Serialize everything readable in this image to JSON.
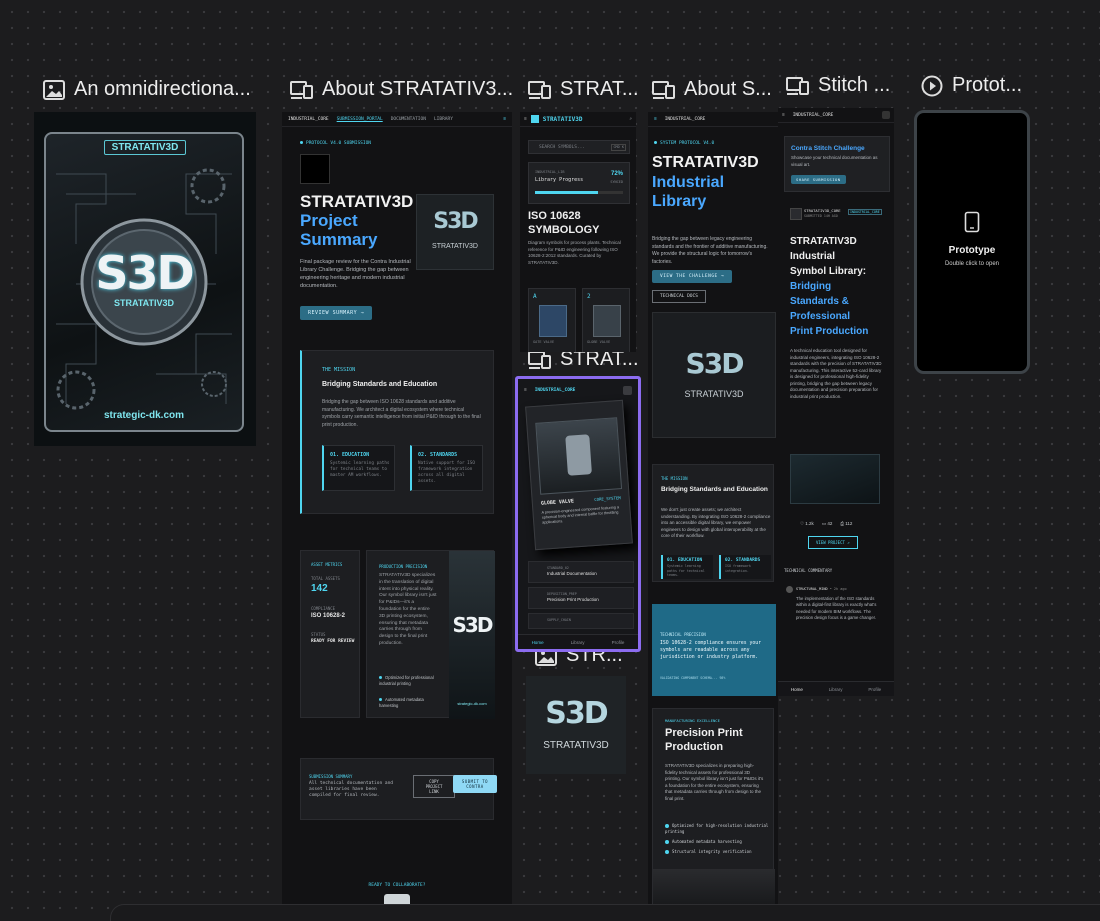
{
  "tiles": [
    {
      "title": "An omnidirectiona..."
    },
    {
      "title": "About STRATATIV3..."
    },
    {
      "title": "STRAT..."
    },
    {
      "title": "About S..."
    },
    {
      "title": "Stitch ..."
    },
    {
      "title": "Protot..."
    },
    {
      "title": "STRAT..."
    },
    {
      "title": "STR..."
    }
  ],
  "card_art": {
    "brand": "STRATATIV3D",
    "logo": "S3D",
    "url": "strategic-dk.com"
  },
  "about1": {
    "nav": [
      "INDUSTRIAL_CORE",
      "SUBMISSION_PORTAL",
      "DOCUMENTATION",
      "LIBRARY"
    ],
    "tag": "PROTOCOL V4.0 SUBMISSION",
    "h1": "STRATATIV3D",
    "h2": "Project",
    "h3": "Summary",
    "logo_text": "STRATATIV3D",
    "intro": "Final package review for the Contra Industrial Library Challenge. Bridging the gap between engineering heritage and modern industrial documentation.",
    "cta": "REVIEW SUMMARY →",
    "mission_tag": "THE MISSION",
    "mission_title": "Bridging Standards and Education",
    "mission_body": "Bridging the gap between ISO 10628 standards and additive manufacturing. We architect a digital ecosystem where technical symbols carry semantic intelligence from initial P&ID through to the final print production.",
    "box1_title": "01. EDUCATION",
    "box1_body": "Systemic learning paths for technical teams to master AM workflows.",
    "box2_title": "02. STANDARDS",
    "box2_body": "Native support for ISO framework integration across all digital assets.",
    "metrics_tag": "ASSET METRICS",
    "total_label": "TOTAL ASSETS",
    "total_value": "142",
    "comp_label": "COMPLIANCE",
    "comp_value": "ISO 10628-2",
    "status_label": "STATUS",
    "status_value": "READY FOR REVIEW",
    "prec_tag": "PRODUCTION PRECISION",
    "prec_body": "STRATATIV3D specializes in the translation of digital intent into physical reality. Our symbol library isn't just for P&IDs—it's a foundation for the entire 3D printing ecosystem, ensuring that metadata carries through from design to the final print production.",
    "prec_b1": "Optimized for professional industrial printing",
    "prec_b2": "Automated metadata harvesting",
    "sub_tag": "SUBMISSION SUMMARY",
    "sub_body": "All technical documentation and asset libraries have been compiled for final review.",
    "copy_btn": "COPY PROJECT LINK",
    "submit_btn": "SUBMIT TO CONTRA",
    "collab": "READY TO COLLABORATE?"
  },
  "strat": {
    "brand": "STRATATIV3D",
    "search": "SEARCH SYMBOLS...",
    "kbd": "CMD K",
    "progress_tag": "INDUSTRIAL_LIB",
    "progress_label": "Library Progress",
    "progress_value": "72%",
    "progress_fraction": 0.72,
    "progress_sub": "SYNCED",
    "title1": "ISO 10628",
    "title2": "SYMBOLOGY",
    "desc": "Diagram symbols for process plants. Technical reference for P&ID engineering following ISO 10628-2:2012 standards. Curated by STRATATIV3D.",
    "sym1_no": "A",
    "sym1_label": "GATE VALVE",
    "sym2_no": "2",
    "sym2_label": "GLOBE VALVE"
  },
  "detail": {
    "brand": "INDUSTRIAL_CORE",
    "card_label": "GLOBE VALVE",
    "card_code": "CORE_SYSTEM",
    "card_desc": "A precision-engineered component featuring a spherical body and internal baffle for throttling applications.",
    "row1_tag": "STANDARD_02",
    "row1_title": "Industrial Documentation",
    "row2_tag": "DEPOSITION_PREP",
    "row2_title": "Precision Print Production",
    "row3_tag": "SUPPLY_CHAIN",
    "nav": [
      "Home",
      "Library",
      "Profile"
    ]
  },
  "small_logo": {
    "text": "STRATATIV3D",
    "logo": "S3D"
  },
  "about2": {
    "brand": "INDUSTRIAL_CORE",
    "tag": "SYSTEM PROTOCOL V4.0",
    "h1": "STRATATIV3D",
    "h2": "Industrial",
    "h3": "Library",
    "intro": "Bridging the gap between legacy engineering standards and the frontier of additive manufacturing. We provide the structural logic for tomorrow's factories.",
    "cta1": "VIEW THE CHALLENGE →",
    "cta2": "TECHNICAL DOCS",
    "logo_text": "STRATATIV3D",
    "mission_tag": "THE MISSION",
    "mission_title": "Bridging Standards and Education",
    "mission_body": "We don't just create assets; we architect understanding. By integrating ISO 10628-2 compliance into an accessible digital library, we empower engineers to design with global interoperability at the core of their workflow.",
    "box1_title": "01. EDUCATION",
    "box1_body": "Systemic learning paths for technical teams.",
    "box2_title": "02. STANDARDS",
    "box2_body": "ISO framework integration.",
    "tp_tag": "TECHNICAL PRECISION",
    "tp_body": "ISO 10628-2 compliance ensures your symbols are readable across any jurisdiction or industry platform.",
    "tp_foot": "VALIDATING COMPONENT SCHEMA... 98%",
    "mfg_tag": "MANUFACTURING EXCELLENCE",
    "mfg_title1": "Precision Print",
    "mfg_title2": "Production",
    "mfg_body": "STRATATIV3D specializes in preparing high-fidelity technical assets for professional 3D printing. Our symbol library isn't just for P&IDs it's a foundation for the entire ecosystem, ensuring that metadata carries through from design to the final print.",
    "b1": "Optimized for high-resolution industrial printing",
    "b2": "Automated metadata harvesting",
    "b3": "Structural integrity verification"
  },
  "stitch": {
    "challenge_title": "Contra Stitch Challenge",
    "challenge_body": "Showcase your technical documentation as visual art.",
    "challenge_btn": "SHARE SUBMISSION",
    "author": "STRATATIV3D_CORE",
    "author_sub": "SUBMITTED 14H AGO",
    "author_badge": "INDUSTRIAL_CORE",
    "t1": "STRATATIV3D",
    "t2": "Industrial",
    "t3": "Symbol Library:",
    "t4": "Bridging",
    "t5": "Standards &",
    "t6": "Professional",
    "t7": "Print Production",
    "body": "A technical education tool designed for industrial engineers, integrating ISO 10628-2 standards with the precision of STRATATIV3D manufacturing. This interactive 52-card library is designed for professional high-fidelity printing, bridging the gap between legacy documentation and precision preparation for industrial print production.",
    "likes": "1.2k",
    "comments": "42",
    "shares": "112",
    "view_btn": "VIEW PROJECT ↗",
    "comm_tag": "TECHNICAL COMMENTARY",
    "c_user": "STRUCTURAL_MIND",
    "c_time": "• 2h ago",
    "c_body": "The implementation of the ISO standards within a digital-first library is exactly what's needed for modern BIM workflows. The precision design focus is a game changer.",
    "nav": [
      "Home",
      "Library",
      "Profile"
    ]
  },
  "proto": {
    "title": "Prototype",
    "sub": "Double click to open"
  }
}
